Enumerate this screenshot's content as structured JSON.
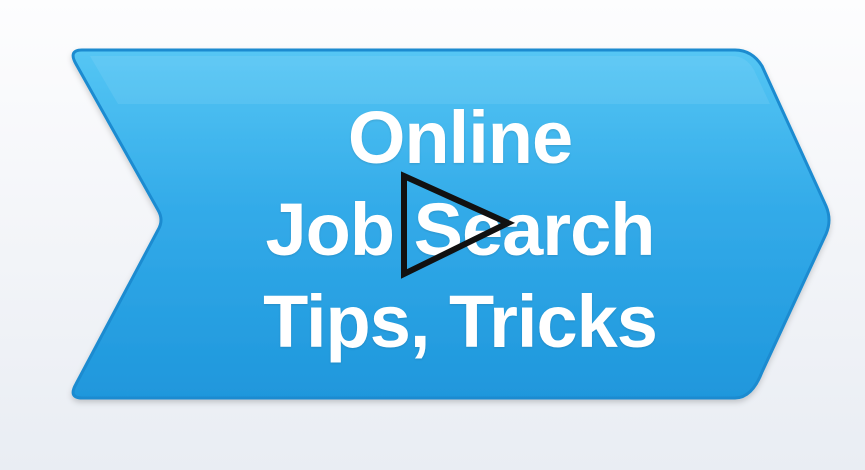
{
  "video": {
    "title_lines": [
      "Online",
      "Job Search",
      "Tips, Tricks"
    ],
    "play_icon": "play-icon",
    "colors": {
      "banner_fill": "#2ba6e6",
      "banner_highlight": "#4cc0f2",
      "banner_edge": "#1a8bd0",
      "text": "#ffffff",
      "play_stroke": "#111111"
    }
  }
}
